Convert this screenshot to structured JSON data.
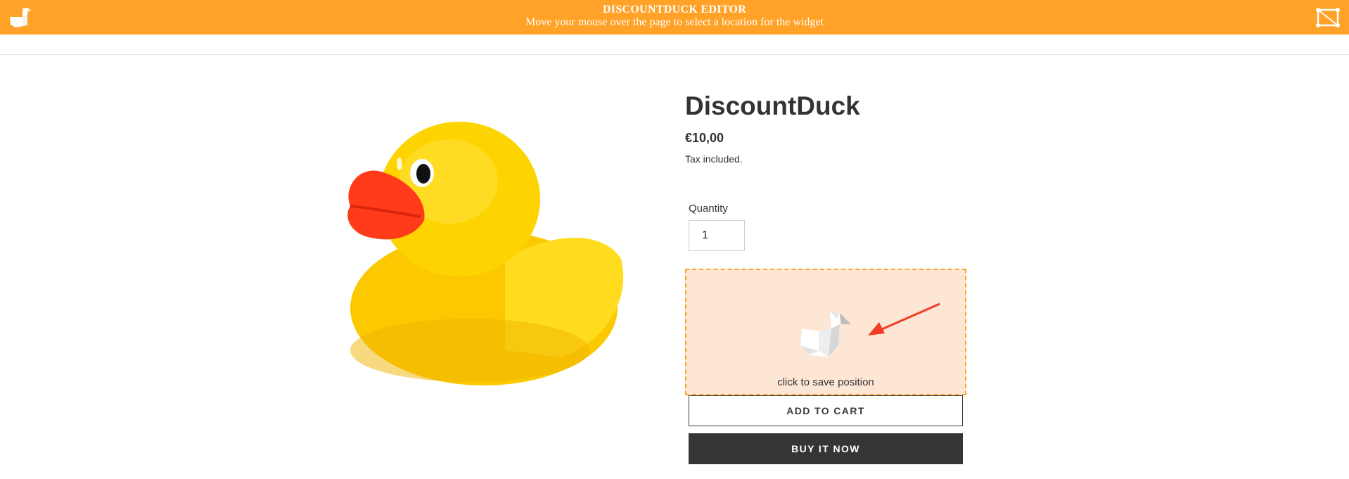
{
  "editor_bar": {
    "title": "DISCOUNTDUCK EDITOR",
    "subtitle": "Move your mouse over the page to select a location for the widget",
    "background_color": "#ffa227",
    "logo_icon": "duck-logo-icon",
    "exit_icon": "exit-editor-icon"
  },
  "product": {
    "title": "DiscountDuck",
    "price": "€10,00",
    "tax_note": "Tax included.",
    "image_icon": "rubber-duck-image"
  },
  "quantity": {
    "label": "Quantity",
    "value": "1"
  },
  "widget": {
    "caption": "click to save position",
    "icon": "duck-widget-icon",
    "arrow_icon": "red-arrow-icon",
    "border_color": "#ffa227",
    "background_color": "#fee6d5"
  },
  "buttons": {
    "add_to_cart": "ADD TO CART",
    "buy_now": "BUY IT NOW"
  }
}
